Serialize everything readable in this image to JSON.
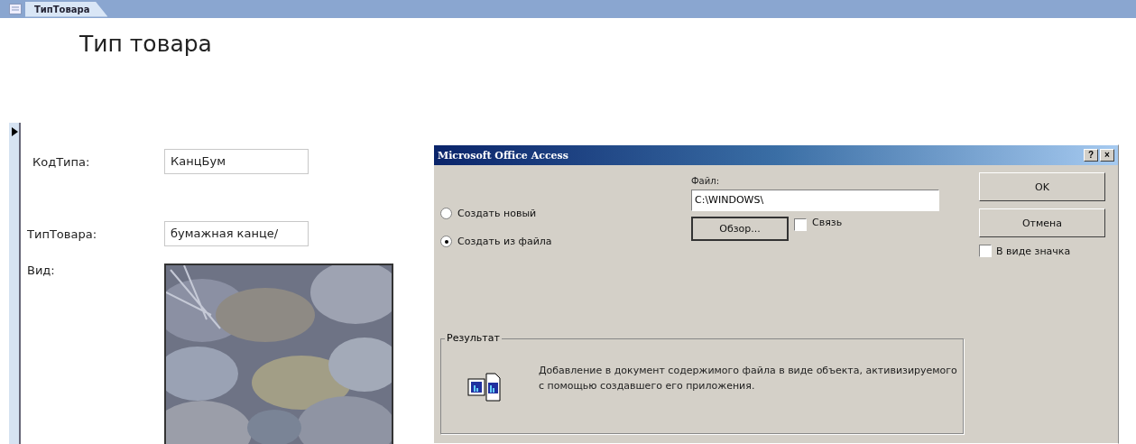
{
  "tabs": [
    {
      "label": "ТипТовара",
      "selected": true
    }
  ],
  "form": {
    "title": "Тип товара",
    "fields": [
      {
        "kind": "text",
        "label": "КодТипа:",
        "value": "КанцБум"
      },
      {
        "kind": "text",
        "label": "ТипТовара:",
        "value": "бумажная канце/"
      },
      {
        "kind": "picture",
        "label": "Вид:"
      }
    ]
  },
  "dialog": {
    "title": "Microsoft Office Access",
    "title_buttons": [
      "?",
      "×"
    ],
    "options": [
      {
        "label": "Создать новый",
        "selected": false
      },
      {
        "label": "Создать из файла",
        "selected": true
      }
    ],
    "file_label": "Файл:",
    "file_value": "C:\\WINDOWS\\",
    "browse_button": "Обзор...",
    "link": {
      "label": "Связь",
      "checked": false
    },
    "buttons": [
      "OK",
      "Отмена"
    ],
    "as_icon": {
      "label": "В виде значка",
      "checked": false
    },
    "result": {
      "label": "Результат",
      "text": "Добавление в документ содержимого файла в виде объекта, активизируемого с помощью создавшего его приложения."
    }
  }
}
